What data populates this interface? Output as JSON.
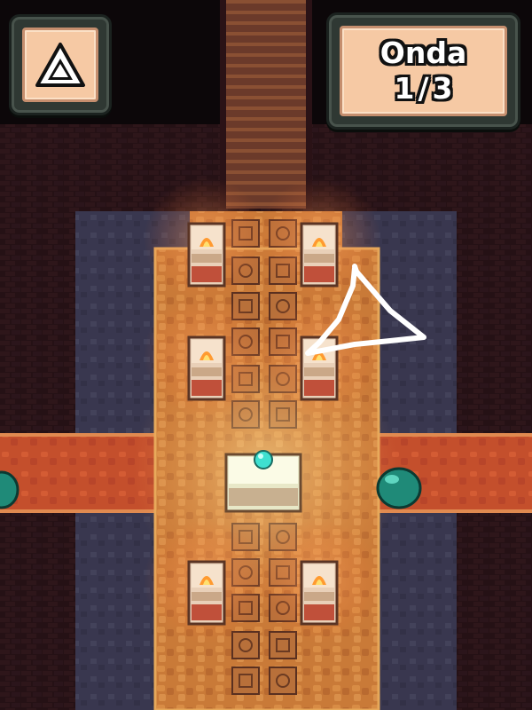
{
  "hud": {
    "shape_button": {
      "icon": "triangle-icon"
    },
    "wave": {
      "label": "Onda",
      "current": "1",
      "separator": "/",
      "total": "3"
    }
  },
  "scene": {
    "drawn_gesture": "triangle",
    "enemies": [
      {
        "type": "teal-slime"
      },
      {
        "type": "teal-slime"
      }
    ],
    "altar_gem_color": "#3fe0d0",
    "colors": {
      "lava_floor": "#c65a2a",
      "carpet": "#d89050",
      "stone_floor": "#4a4a6a",
      "wall": "#3a1a1e"
    }
  }
}
